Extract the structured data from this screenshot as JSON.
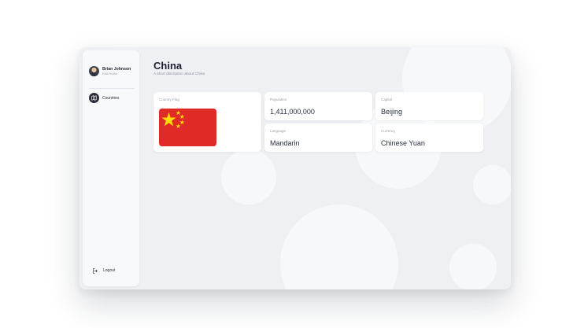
{
  "user": {
    "name": "Brian Johnson",
    "subtitle": "Edit Profile"
  },
  "sidebar": {
    "items": [
      {
        "label": "Countries",
        "icon": "map-icon"
      }
    ]
  },
  "logout": {
    "label": "Logout",
    "icon": "logout-icon"
  },
  "page": {
    "title": "China",
    "subtitle": "A short discription about China"
  },
  "flag_card": {
    "label": "Country Flag",
    "flag": "flag-of-china",
    "colors": {
      "field": "#e02a26",
      "stars": "#ffde00"
    }
  },
  "cards": {
    "population": {
      "label": "Population",
      "value": "1,411,000,000"
    },
    "capital": {
      "label": "Capital",
      "value": "Beijing"
    },
    "language": {
      "label": "Language",
      "value": "Mandarin"
    },
    "currency": {
      "label": "Currency",
      "value": "Chinese Yuan"
    }
  }
}
